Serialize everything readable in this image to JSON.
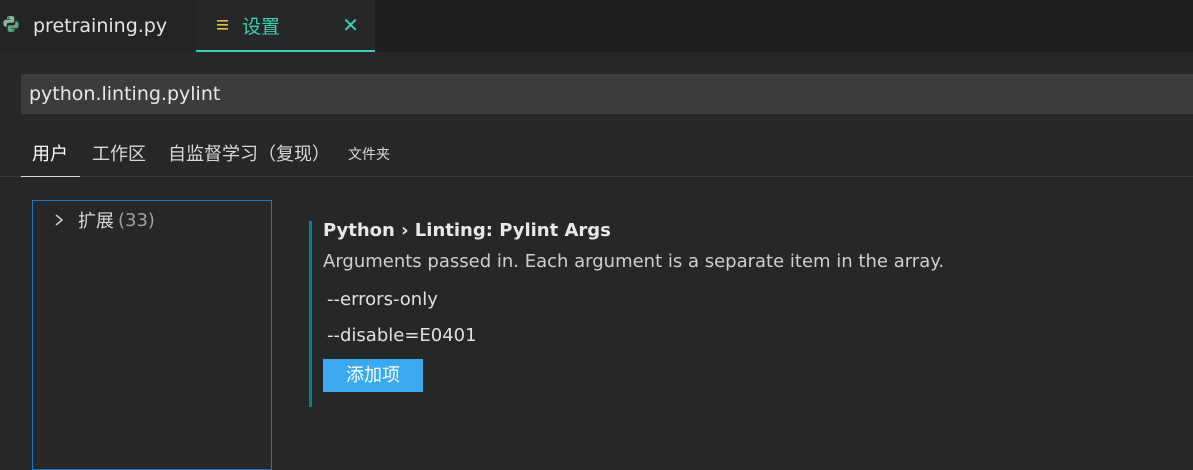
{
  "tabs": [
    {
      "label": "pretraining.py",
      "icon": "python-icon"
    },
    {
      "label": "设置",
      "icon": "settings-list-icon",
      "close_symbol": "✕"
    }
  ],
  "search": {
    "value": "python.linting.pylint"
  },
  "scope_tabs": [
    {
      "label": "用户"
    },
    {
      "label": "工作区"
    },
    {
      "label": "自监督学习（复现）"
    },
    {
      "label": "文件夹"
    }
  ],
  "toc": {
    "items": [
      {
        "label": "扩展",
        "count": "(33)"
      }
    ]
  },
  "setting": {
    "category": "Python › Linting: ",
    "name": "Pylint Args",
    "description": "Arguments passed in. Each argument is a separate item in the array.",
    "values": [
      "--errors-only",
      "--disable=E0401"
    ],
    "add_label": "添加项"
  },
  "colors": {
    "accent": "#3ccfb5",
    "button": "#3ba9ef",
    "focus_border": "#1577c4",
    "modified_indicator": "#0f7a96"
  }
}
